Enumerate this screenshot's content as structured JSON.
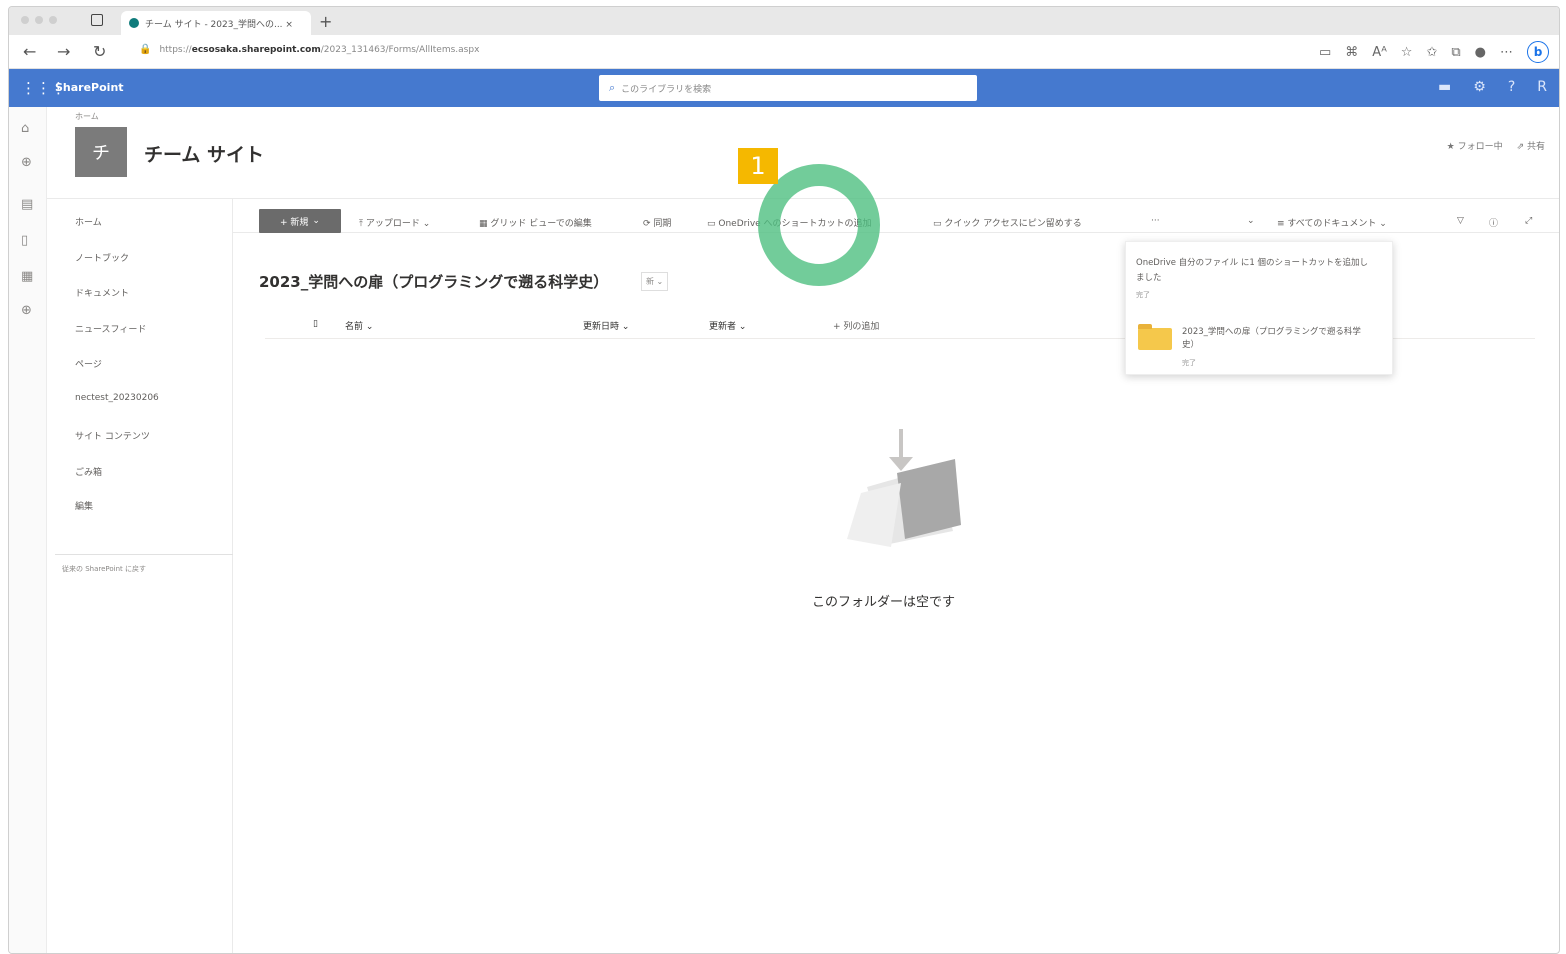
{
  "browser": {
    "tab_title": "チーム サイト - 2023_学問への... ×",
    "url_prefix": "https://",
    "url_domain": "ecsosaka.sharepoint.com",
    "url_path": "/2023_131463/Forms/AllItems.aspx"
  },
  "suite": {
    "brand": "SharePoint",
    "search_placeholder": "このライブラリを検索"
  },
  "site": {
    "breadcrumb": "ホーム",
    "logo_letter": "チ",
    "title": "チーム サイト",
    "follow": "★ フォロー中",
    "share": "共有"
  },
  "leftnav": {
    "items": [
      "ホーム",
      "ノートブック",
      "ドキュメント",
      "ニュースフィード",
      "ページ",
      "nectest_20230206",
      "サイト コンテンツ",
      "ごみ箱",
      "編集"
    ],
    "return_link": "従来の SharePoint に戻す"
  },
  "commands": {
    "new": "+ 新規",
    "upload": "アップロード",
    "grid_edit": "グリッド ビューでの編集",
    "sync": "同期",
    "onedrive_shortcut": "OneDrive へのショートカットの追加",
    "pin": "クイック アクセスにピン留めする",
    "more": "···",
    "view": "すべてのドキュメント"
  },
  "library": {
    "title": "2023_学問への扉（プログラミングで遡る科学史）",
    "badge": "新"
  },
  "columns": {
    "name": "名前",
    "modified": "更新日時",
    "modified_by": "更新者",
    "add_column": "+ 列の追加"
  },
  "empty_message": "このフォルダーは空です",
  "notification": {
    "message": "OneDrive 自分のファイル に1 個のショートカットを追加しました",
    "status_top": "完了",
    "folder_name": "2023_学問への扉（プログラミングで遡る科学史）",
    "status_bottom": "完了"
  },
  "annotation": {
    "step": "1"
  },
  "colors": {
    "suite_bar": "#4579cf",
    "step_badge": "#f5b800",
    "ring": "#4abe7e"
  }
}
